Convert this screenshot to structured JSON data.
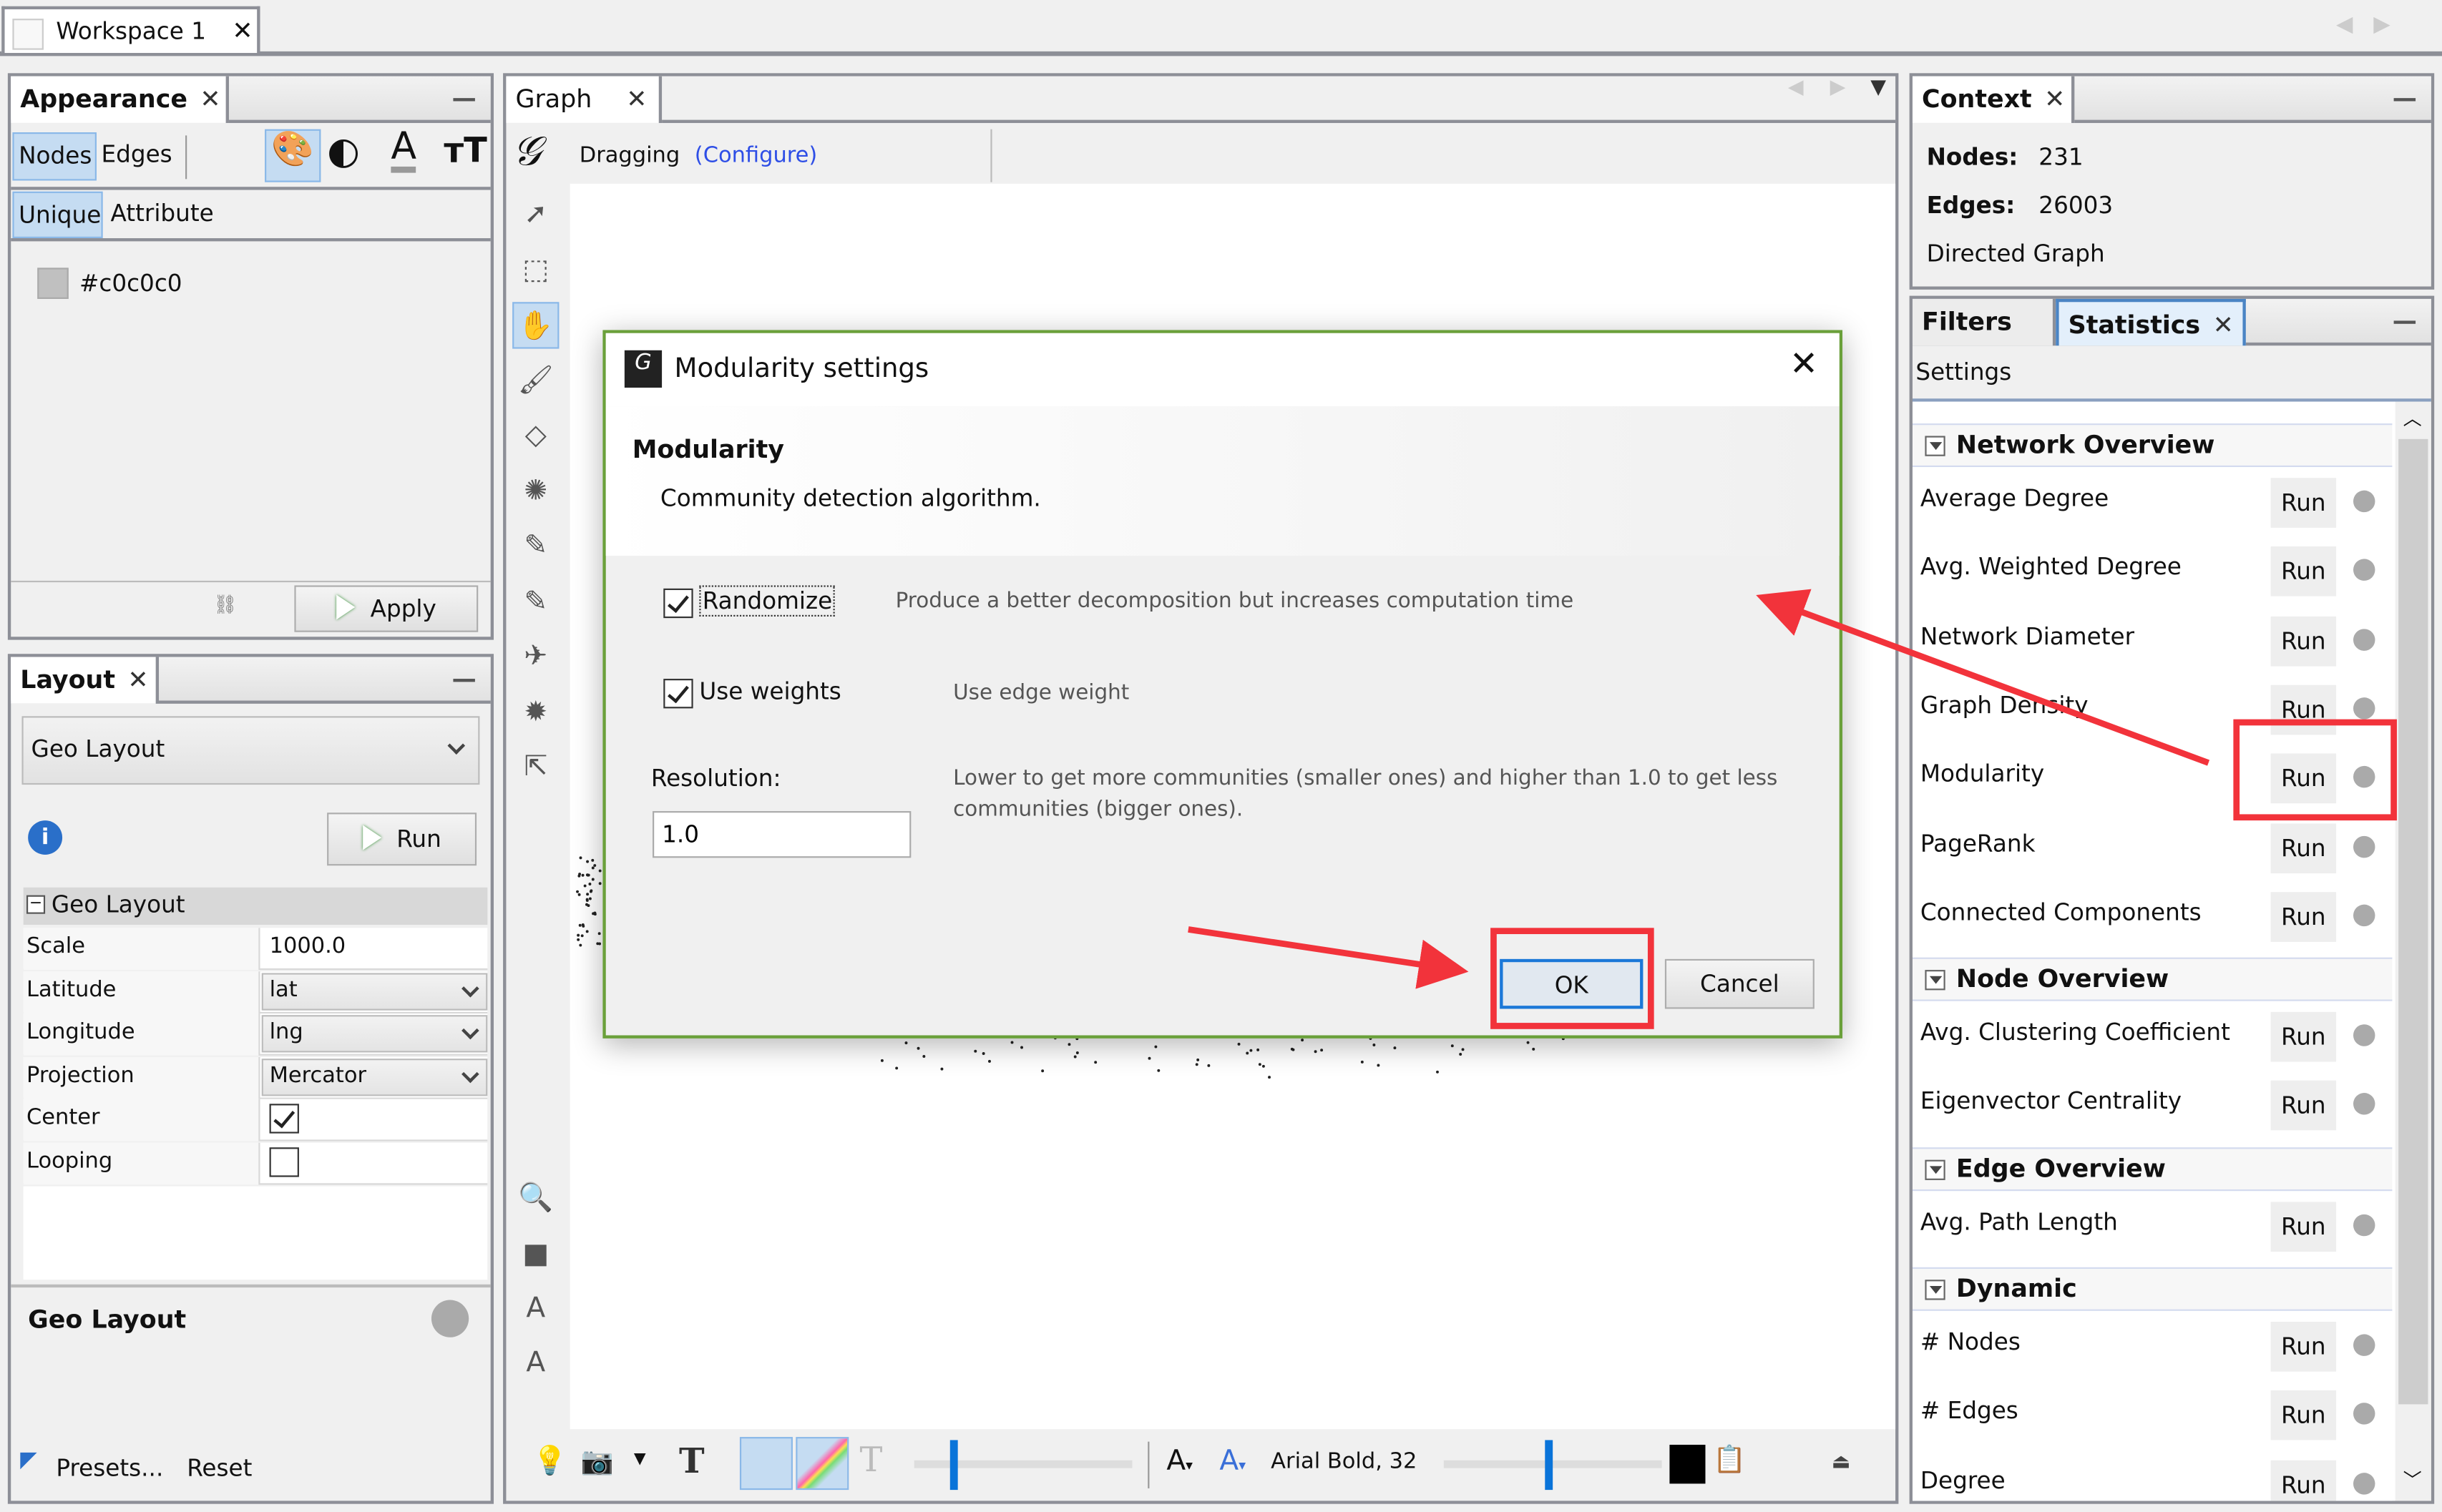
{
  "workspace_tab": {
    "label": "Workspace 1"
  },
  "appearance": {
    "title": "Appearance",
    "element_tabs": [
      "Nodes",
      "Edges"
    ],
    "mode_tabs": [
      "Unique",
      "Attribute"
    ],
    "color_value": "#c0c0c0",
    "apply_label": "Apply"
  },
  "layout": {
    "title": "Layout",
    "selected_layout": "Geo Layout",
    "run_label": "Run",
    "section": "Geo Layout",
    "properties": [
      {
        "key": "Scale",
        "value": "1000.0",
        "type": "text"
      },
      {
        "key": "Latitude",
        "value": "lat",
        "type": "combo"
      },
      {
        "key": "Longitude",
        "value": "lng",
        "type": "combo"
      },
      {
        "key": "Projection",
        "value": "Mercator",
        "type": "combo"
      },
      {
        "key": "Center",
        "value": true,
        "type": "check"
      },
      {
        "key": "Looping",
        "value": false,
        "type": "check"
      }
    ],
    "description_title": "Geo Layout",
    "presets_label": "Presets...",
    "reset_label": "Reset"
  },
  "graph": {
    "title": "Graph",
    "mode": "Dragging",
    "configure_label": "(Configure)",
    "font_label": "Arial Bold, 32"
  },
  "dialog": {
    "title": "Modularity settings",
    "heading": "Modularity",
    "subheading": "Community detection algorithm.",
    "randomize_label": "Randomize",
    "randomize_checked": true,
    "randomize_desc": "Produce a better decomposition but increases computation time",
    "weights_label": "Use weights",
    "weights_checked": true,
    "weights_desc": "Use edge weight",
    "resolution_label": "Resolution:",
    "resolution_value": "1.0",
    "resolution_desc_1": "Lower to get more communities (smaller ones) and higher than 1.0 to get less",
    "resolution_desc_2": "communities (bigger ones).",
    "ok_label": "OK",
    "cancel_label": "Cancel"
  },
  "context": {
    "title": "Context",
    "nodes_label": "Nodes:",
    "nodes_value": "231",
    "edges_label": "Edges:",
    "edges_value": "26003",
    "graph_type": "Directed Graph"
  },
  "statistics": {
    "tabs": [
      "Filters",
      "Statistics"
    ],
    "settings_label": "Settings",
    "run_label": "Run",
    "sections": [
      {
        "title": "Network Overview",
        "items": [
          "Average Degree",
          "Avg. Weighted Degree",
          "Network Diameter",
          "Graph Density",
          "Modularity",
          "PageRank",
          "Connected Components"
        ]
      },
      {
        "title": "Node Overview",
        "items": [
          "Avg. Clustering Coefficient",
          "Eigenvector Centrality"
        ]
      },
      {
        "title": "Edge Overview",
        "items": [
          "Avg. Path Length"
        ]
      },
      {
        "title": "Dynamic",
        "items": [
          "# Nodes",
          "# Edges",
          "Degree"
        ]
      }
    ]
  },
  "annotations": {
    "highlight_color": "#f2333b"
  }
}
